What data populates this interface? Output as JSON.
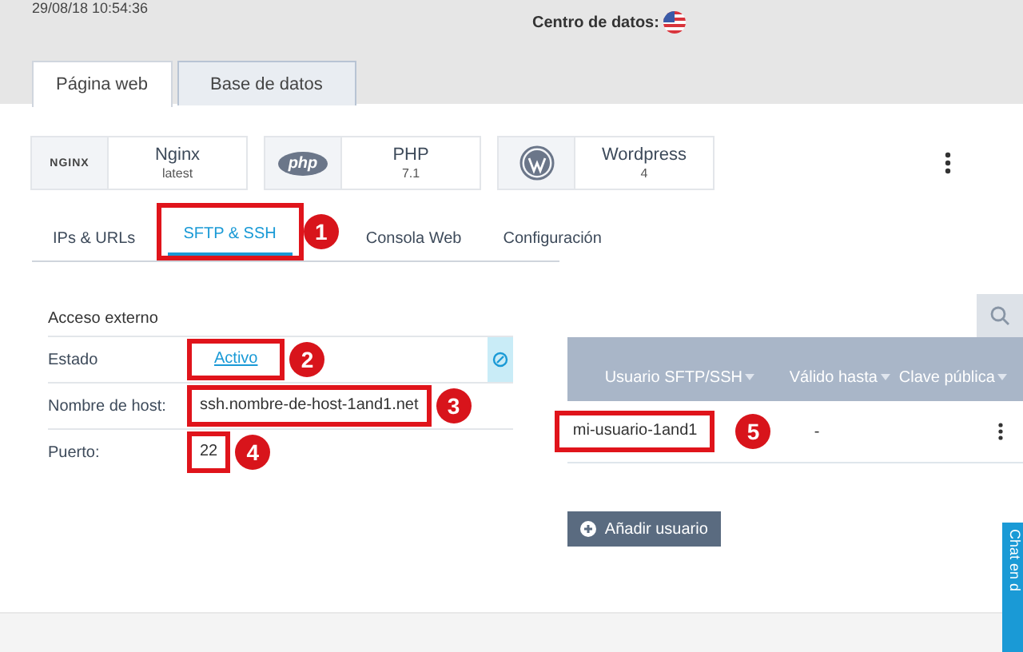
{
  "header": {
    "timestamp": "29/08/18 10:54:36",
    "datacenter_label": "Centro de datos:"
  },
  "page_tabs": [
    {
      "label": "Página web",
      "selected": true
    },
    {
      "label": "Base de datos",
      "selected": false
    }
  ],
  "apps": [
    {
      "kind": "nginx",
      "logo_text": "NGINX",
      "name": "Nginx",
      "version": "latest"
    },
    {
      "kind": "php",
      "logo_text": "php",
      "name": "PHP",
      "version": "7.1"
    },
    {
      "kind": "wordpress",
      "name": "Wordpress",
      "version": "4"
    }
  ],
  "section_tabs": [
    {
      "label": "IPs & URLs",
      "selected": false
    },
    {
      "label": "SFTP & SSH",
      "selected": true
    },
    {
      "label": "Consola Web",
      "selected": false
    },
    {
      "label": "Configuración",
      "selected": false
    }
  ],
  "access": {
    "title": "Acceso externo",
    "rows": [
      {
        "label": "Estado",
        "value": "Activo",
        "kind": "link"
      },
      {
        "label": "Nombre de host:",
        "value": "ssh.nombre-de-host-1and1.net",
        "kind": "text"
      },
      {
        "label": "Puerto:",
        "value": "22",
        "kind": "text"
      }
    ]
  },
  "users_table": {
    "columns": [
      {
        "label": "Usuario SFTP/SSH"
      },
      {
        "label": "Válido hasta"
      },
      {
        "label": "Clave pública"
      }
    ],
    "rows": [
      {
        "cells": [
          "mi-usuario-1and1",
          "-"
        ]
      }
    ]
  },
  "add_button": "Añadir usuario",
  "chat_tab": "Chat en d",
  "annotations": [
    {
      "number": "1"
    },
    {
      "number": "2"
    },
    {
      "number": "3"
    },
    {
      "number": "4"
    },
    {
      "number": "5"
    }
  ]
}
